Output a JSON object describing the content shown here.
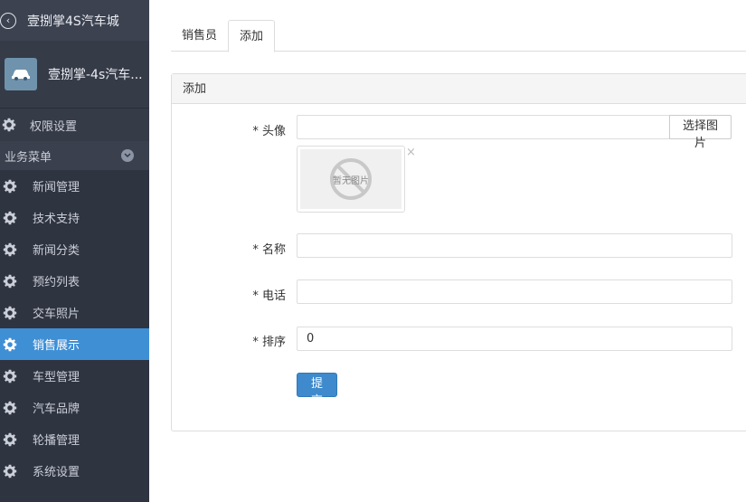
{
  "sidebar": {
    "back_title": "壹捌掌4S汽车城",
    "store_name": "壹捌掌-4s汽车...",
    "permission_item": "权限设置",
    "section_label": "业务菜单",
    "items": [
      {
        "label": "新闻管理",
        "active": false
      },
      {
        "label": "技术支持",
        "active": false
      },
      {
        "label": "新闻分类",
        "active": false
      },
      {
        "label": "预约列表",
        "active": false
      },
      {
        "label": "交车照片",
        "active": false
      },
      {
        "label": "销售展示",
        "active": true
      },
      {
        "label": "车型管理",
        "active": false
      },
      {
        "label": "汽车品牌",
        "active": false
      },
      {
        "label": "轮播管理",
        "active": false
      },
      {
        "label": "系统设置",
        "active": false
      }
    ]
  },
  "tabs": [
    {
      "label": "销售员",
      "active": false
    },
    {
      "label": "添加",
      "active": true
    }
  ],
  "panel": {
    "title": "添加",
    "avatar_label": "* 头像",
    "avatar_value": "",
    "choose_button": "选择图片",
    "no_image_text": "暂无图片",
    "remove_symbol": "×",
    "name_label": "* 名称",
    "name_value": "",
    "phone_label": "* 电话",
    "phone_value": "",
    "sort_label": "* 排序",
    "sort_value": "0",
    "submit_button": "提交"
  },
  "colors": {
    "sidebar_bg": "#2f3441",
    "active_item": "#3f8fd5",
    "submit_button": "#3e8acc"
  }
}
